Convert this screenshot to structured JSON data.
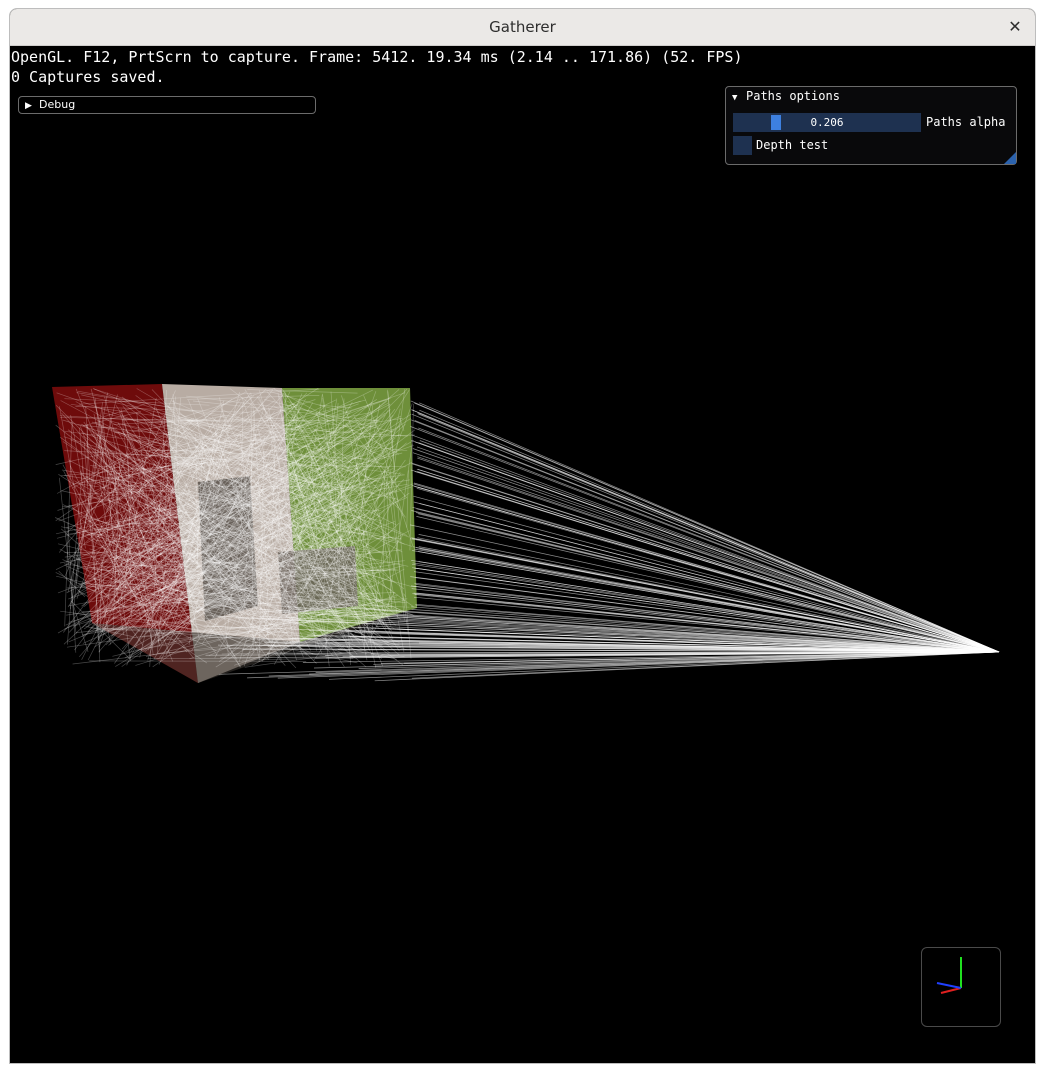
{
  "window": {
    "title": "Gatherer"
  },
  "hud": {
    "line1": "OpenGL. F12, PrtScrn to capture. Frame: 5412. 19.34 ms (2.14 .. 171.86) (52. FPS)",
    "line2": "0 Captures saved."
  },
  "debug": {
    "label": "Debug",
    "expanded": false
  },
  "paths_options": {
    "title": "Paths options",
    "expanded": true,
    "alpha_value": "0.206",
    "alpha_fraction": 0.206,
    "alpha_label": "Paths alpha",
    "depth_label": "Depth test",
    "depth_checked": false
  },
  "colors": {
    "background": "#000000",
    "wall_left": "#6e0b0b",
    "wall_back": "#b8aca3",
    "wall_right": "#6e8f3a",
    "paths": "#ffffff",
    "ui_frame": "#1e3150",
    "ui_accent": "#3d80e0",
    "axis_x": "#e02020",
    "axis_y": "#20e020",
    "axis_z": "#2040ff"
  },
  "icons": {
    "close": "close-icon",
    "collapsed": "triangle-right-icon",
    "expanded": "triangle-down-icon"
  }
}
